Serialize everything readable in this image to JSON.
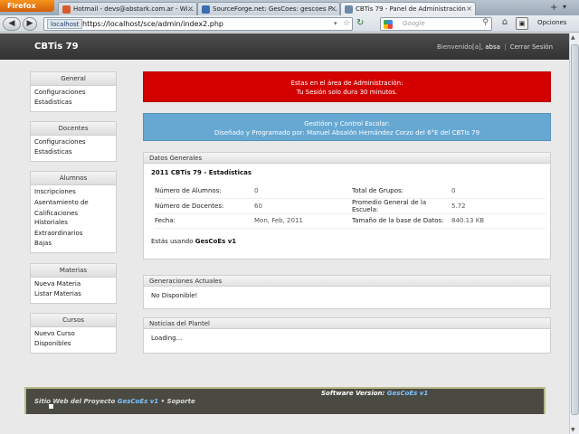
{
  "browser": {
    "menu_button": "Firefox",
    "tabs": [
      {
        "label": "Hotmail - devs@abstark.com.ar - Wi...",
        "color": "#d85a2a"
      },
      {
        "label": "SourceForge.net: GesCoes: gescoes P...",
        "color": "#3b6db3"
      },
      {
        "label": "CBTis 79 - Panel de Administración",
        "color": "#6a8aa8"
      }
    ],
    "new_tab_icon": "plus-icon",
    "url_site": "localhost",
    "url": "https://localhost/sce/admin/index2.php",
    "search_placeholder": "Google",
    "options_label": "Opciones"
  },
  "site": {
    "title": "CBTis 79",
    "welcome": "Bienvenido[a],",
    "user": "absa",
    "separator": "|",
    "logout": "Cerrar Sesión"
  },
  "sidebar": [
    {
      "title": "General",
      "items": [
        "Configuraciones",
        "Estadisticas"
      ]
    },
    {
      "title": "Docentes",
      "items": [
        "Configuraciones",
        "Estadisticas"
      ]
    },
    {
      "title": "Alumnos",
      "items": [
        "Inscripciones",
        "Asentamiento de Calificaciones",
        "Historiales",
        "Extraordinarios",
        "Bajas"
      ]
    },
    {
      "title": "Materias",
      "items": [
        "Nueva Materia",
        "Listar Materias"
      ]
    },
    {
      "title": "Cursos",
      "items": [
        "Nuevo Curso",
        "Disponibles"
      ]
    }
  ],
  "alert": {
    "line1": "Estas en el área de Administración:",
    "line2": "Tu Sesión solo dura 30 minutos."
  },
  "info": {
    "line1": "Gestióon y Control Escolar:",
    "line2": "Diseñado y Programado por: Manuel Absalón Hernández Corzo del 6°E del CBTis 79"
  },
  "datos": {
    "header": "Datos Generales",
    "title": "2011 CBTis 79 - Estadísticas",
    "rows": [
      [
        "Número de Alumnos:",
        "0",
        "Total de Grupos:",
        "0"
      ],
      [
        "Número de Docentes:",
        "60",
        "Promedio General de la Escuela:",
        "5.72"
      ],
      [
        "Fecha:",
        "Mon, Feb, 2011",
        "Tamaño de la base de Datos:",
        "840.13 KB"
      ]
    ],
    "using_prefix": "Estás usando",
    "using_name": "GesCoEs v1"
  },
  "generaciones": {
    "header": "Generaciones Actuales",
    "body": "No Disponible!"
  },
  "noticias": {
    "header": "Noticias del Plantel",
    "body": "Loading..."
  },
  "footer": {
    "version_label": "Software Version:",
    "version_value": "GesCoEs v1",
    "site_prefix": "Sitio Web del Proyecto",
    "site_link": "GesCoEs v1",
    "bullet": "•",
    "support": "Soporte"
  }
}
